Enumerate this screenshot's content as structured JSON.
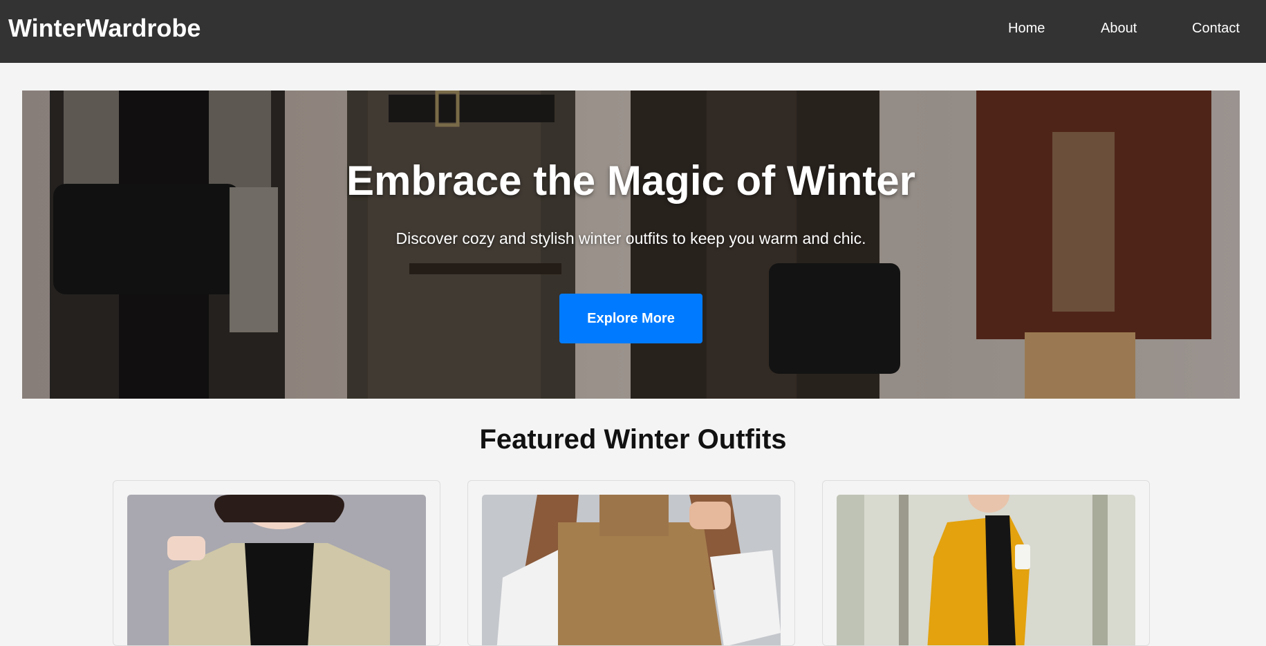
{
  "navbar": {
    "brand": "WinterWardrobe",
    "links": [
      "Home",
      "About",
      "Contact"
    ]
  },
  "hero": {
    "title": "Embrace the Magic of Winter",
    "subtitle": "Discover cozy and stylish winter outfits to keep you warm and chic.",
    "button_label": "Explore More"
  },
  "featured": {
    "title": "Featured Winter Outfits",
    "cards": [
      {
        "image": "beige blazer outfit photo"
      },
      {
        "image": "knit sweater vest outfit photo"
      },
      {
        "image": "mustard coat outfit photo"
      }
    ]
  },
  "colors": {
    "navbar_bg": "#333333",
    "page_bg": "#f4f4f4",
    "accent": "#007bff"
  }
}
